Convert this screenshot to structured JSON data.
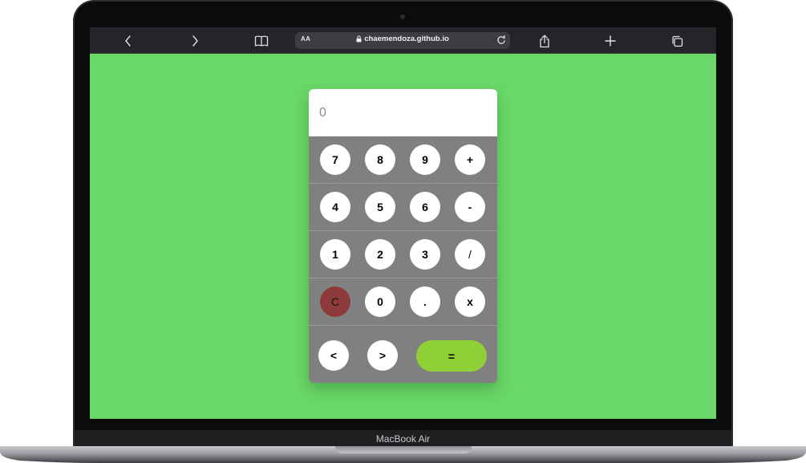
{
  "device": {
    "model_label": "MacBook Air"
  },
  "browser": {
    "address_bar": {
      "text_size_label": "AA",
      "url": "chaemendoza.github.io"
    },
    "icons": {
      "back": "chevron-left-icon",
      "forward": "chevron-right-icon",
      "bookmarks": "book-icon",
      "lock": "lock-icon",
      "reload": "reload-icon",
      "share": "share-icon",
      "new_tab": "plus-icon",
      "tabs": "tabs-icon"
    }
  },
  "calculator": {
    "display_value": "0",
    "rows": [
      [
        "7",
        "8",
        "9",
        "+"
      ],
      [
        "4",
        "5",
        "6",
        "-"
      ],
      [
        "1",
        "2",
        "3",
        "/"
      ],
      [
        "C",
        "0",
        ".",
        "x"
      ]
    ],
    "bottom": {
      "prev_label": "<",
      "next_label": ">",
      "equals_label": "="
    }
  },
  "colors": {
    "page_background": "#69d868",
    "keypad_background": "#808080",
    "clear_key": "#8e3a3a",
    "equals_key": "#8fd036",
    "toolbar": "#232529"
  }
}
